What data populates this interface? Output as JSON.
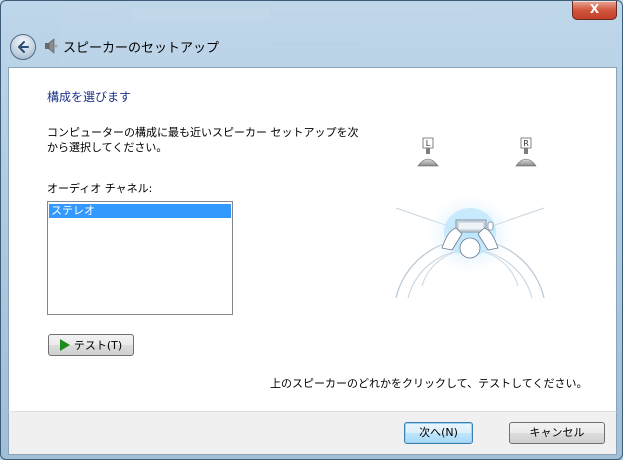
{
  "window": {
    "title": "スピーカーのセットアップ",
    "close_label": "X"
  },
  "main": {
    "heading": "構成を選びます",
    "description": "コンピューターの構成に最も近いスピーカー セットアップを次から選択してください。",
    "channel_label": "オーディオ チャネル:",
    "channels": [
      "ステレオ"
    ],
    "selected_channel": "ステレオ",
    "test_button": "テスト(T)",
    "speaker_left_label": "L",
    "speaker_right_label": "R",
    "hint": "上のスピーカーのどれかをクリックして、テストしてください。"
  },
  "footer": {
    "next_button": "次へ(N)",
    "cancel_button": "キャンセル"
  },
  "colors": {
    "heading": "#1e3287",
    "selection": "#3399ff",
    "play_icon": "#1c8c1c"
  }
}
